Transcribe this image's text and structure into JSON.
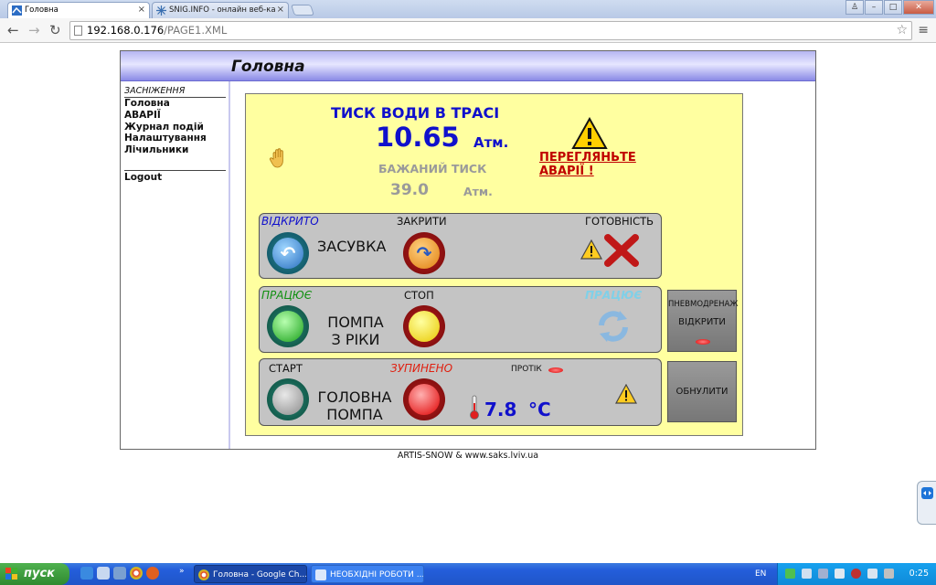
{
  "browser": {
    "tabs": [
      {
        "title": "Головна",
        "active": true
      },
      {
        "title": "SNIG.INFO - онлайн веб-ка",
        "active": false
      }
    ],
    "url_host": "192.168.0.176",
    "url_path": "/PAGE1.XML"
  },
  "page": {
    "header_title": "Головна",
    "footer": "ARTIS-SNOW & www.saks.lviv.ua"
  },
  "sidebar": {
    "heading": "ЗАСНІЖЕННЯ",
    "items": [
      "Головна",
      "АВАРІЇ",
      "Журнал подій",
      "Налаштування",
      "Лічильники"
    ],
    "logout": "Logout"
  },
  "pressure": {
    "title": "ТИСК ВОДИ В ТРАСІ",
    "value": "10.65",
    "unit": "Атм.",
    "desired_title": "БАЖАНИЙ ТИСК",
    "desired_value": "39.0",
    "desired_unit": "Атм.",
    "alarm_link_line1": "ПЕРЕГЛЯНЬТЕ",
    "alarm_link_line2": "АВАРІЇ !"
  },
  "valve": {
    "status": "ВІДКРИТО",
    "close_label": "ЗАКРИТИ",
    "name": "ЗАСУВКА",
    "ready_label": "ГОТОВНІСТЬ"
  },
  "river_pump": {
    "status": "ПРАЦЮЄ",
    "stop_label": "СТОП",
    "name_line1": "ПОМПА",
    "name_line2": "З РІКИ",
    "status_right": "ПРАЦЮЄ"
  },
  "main_pump": {
    "start_label": "СТАРТ",
    "status": "ЗУПИНЕНО",
    "flow_label": "ПРОТІК",
    "name_line1": "ГОЛОВНА",
    "name_line2": "ПОМПА",
    "temperature": "7.8",
    "temperature_unit": "°C"
  },
  "side_buttons": {
    "drain_title": "ПНЕВМОДРЕНАЖ",
    "drain_state": "ВІДКРИТИ",
    "reset": "ОБНУЛИТИ"
  },
  "taskbar": {
    "start": "пуск",
    "items": [
      "Головна - Google Ch...",
      "НЕОБХІДНІ РОБОТИ ..."
    ],
    "lang": "EN",
    "clock": "0:25"
  },
  "colors": {
    "panel_bg": "#ffffa0",
    "accent_blue": "#1010cc",
    "alarm_red": "#c00000",
    "header_gradient": "#8a8ae6"
  }
}
